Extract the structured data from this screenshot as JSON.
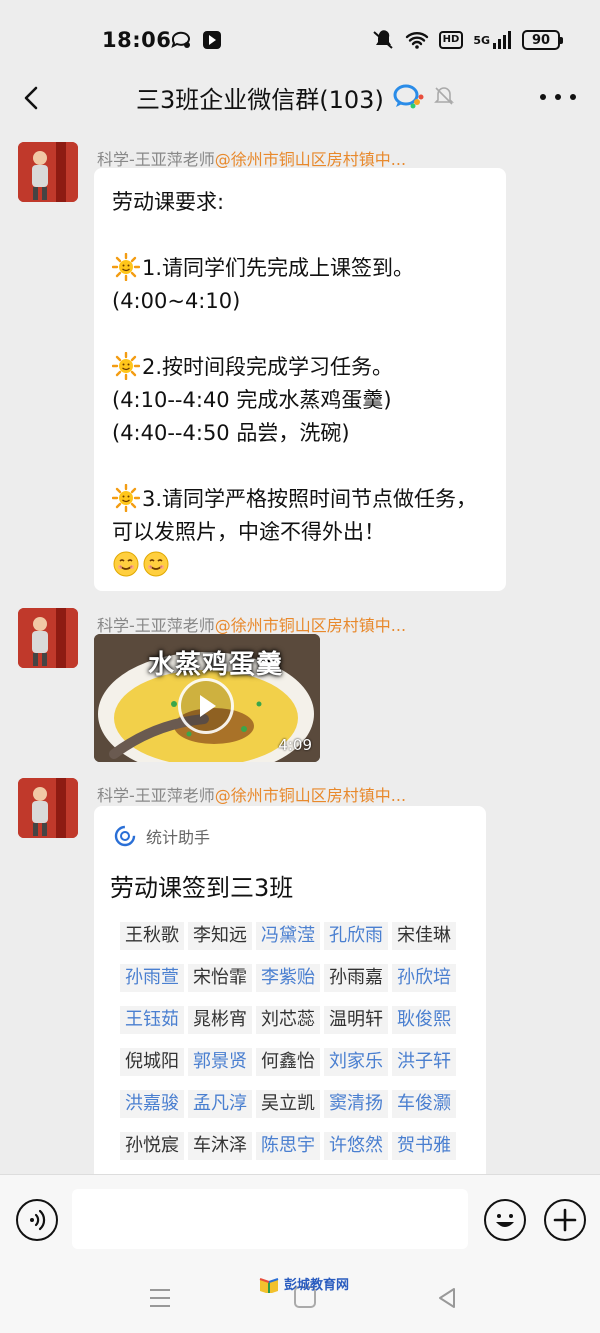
{
  "status_bar": {
    "time": "18:06",
    "network": "5G",
    "battery": "90",
    "hd": "HD"
  },
  "header": {
    "title": "三3班企业微信群(103)"
  },
  "messages": [
    {
      "sender_name": "科学-王亚萍老师",
      "sender_org": "@徐州市铜山区房村镇中...",
      "lines": [
        "劳动课要求:",
        "",
        "1.请同学们先完成上课签到。",
        "(4:00~4:10)",
        "",
        "2.按时间段完成学习任务。",
        "(4:10--4:40 完成水蒸鸡蛋羹)",
        "(4:40--4:50 品尝，洗碗)",
        "",
        "3.请同学严格按照时间节点做任务，可以发照片，中途不得外出！"
      ]
    },
    {
      "sender_name": "科学-王亚萍老师",
      "sender_org": "@徐州市铜山区房村镇中...",
      "video_title": "水蒸鸡蛋羹",
      "video_duration": "4:09"
    },
    {
      "sender_name": "科学-王亚萍老师",
      "sender_org": "@徐州市铜山区房村镇中...",
      "card_source": "统计助手",
      "card_title": "劳动课签到三3班",
      "names": [
        {
          "name": "王秋歌",
          "color": "#333333"
        },
        {
          "name": "李知远",
          "color": "#333333"
        },
        {
          "name": "冯黛滢",
          "color": "#4a7fd0"
        },
        {
          "name": "孔欣雨",
          "color": "#4a7fd0"
        },
        {
          "name": "宋佳琳",
          "color": "#333333"
        },
        {
          "name": "孙雨萱",
          "color": "#4a7fd0"
        },
        {
          "name": "宋怡霏",
          "color": "#333333"
        },
        {
          "name": "李紫贻",
          "color": "#4a7fd0"
        },
        {
          "name": "孙雨嘉",
          "color": "#333333"
        },
        {
          "name": "孙欣培",
          "color": "#4a7fd0"
        },
        {
          "name": "王钰茹",
          "color": "#4a7fd0"
        },
        {
          "name": "晁彬宵",
          "color": "#333333"
        },
        {
          "name": "刘芯蕊",
          "color": "#333333"
        },
        {
          "name": "温明轩",
          "color": "#333333"
        },
        {
          "name": "耿俊熙",
          "color": "#4a7fd0"
        },
        {
          "name": "倪城阳",
          "color": "#333333"
        },
        {
          "name": "郭景贤",
          "color": "#4a7fd0"
        },
        {
          "name": "何鑫怡",
          "color": "#333333"
        },
        {
          "name": "刘家乐",
          "color": "#4a7fd0"
        },
        {
          "name": "洪子轩",
          "color": "#4a7fd0"
        },
        {
          "name": "洪嘉骏",
          "color": "#4a7fd0"
        },
        {
          "name": "孟凡淳",
          "color": "#4a7fd0"
        },
        {
          "name": "吴立凯",
          "color": "#333333"
        },
        {
          "name": "窦清扬",
          "color": "#4a7fd0"
        },
        {
          "name": "车俊灏",
          "color": "#4a7fd0"
        },
        {
          "name": "孙悦宸",
          "color": "#333333"
        },
        {
          "name": "车沐泽",
          "color": "#333333"
        },
        {
          "name": "陈思宇",
          "color": "#4a7fd0"
        },
        {
          "name": "许悠然",
          "color": "#4a7fd0"
        },
        {
          "name": "贺书雅",
          "color": "#4a7fd0"
        }
      ]
    }
  ],
  "watermark": "彭城教育网",
  "colors": {
    "org_orange": "#e8892c",
    "name_blue": "#4a7fd0",
    "background": "#ededed"
  }
}
